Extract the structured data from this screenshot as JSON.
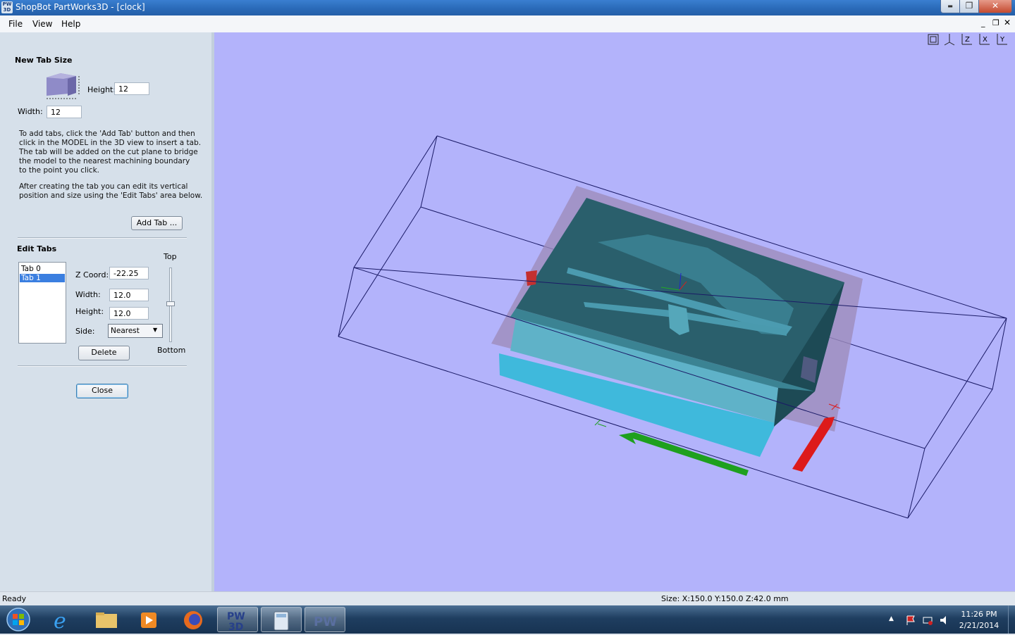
{
  "window": {
    "title": "ShopBot PartWorks3D - [clock]",
    "app_icon_text": "PW\n3D",
    "min_glyph": "▬",
    "max_glyph": "❐",
    "close_glyph": "✕"
  },
  "menubar": {
    "items": [
      "File",
      "View",
      "Help"
    ],
    "mdi_min": "_",
    "mdi_restore": "❐",
    "mdi_close": "✕"
  },
  "tab_size": {
    "heading": "New Tab Size",
    "height_label": "Height:",
    "height_value": "12",
    "width_label": "Width:",
    "width_value": "12",
    "instructions_1": [
      "To add tabs, click the 'Add Tab' button and then",
      "click in the MODEL in the 3D view to insert a tab.",
      "The tab will be added on the cut plane to bridge",
      "the model to the nearest machining boundary",
      "to the point you click."
    ],
    "instructions_2": [
      "After creating the tab you can edit its vertical",
      "position and size using the 'Edit Tabs' area below."
    ],
    "add_tab_label": "Add Tab ..."
  },
  "edit_tabs": {
    "heading": "Edit Tabs",
    "tabs": [
      "Tab 0",
      "Tab 1"
    ],
    "selected_index": 1,
    "z_label": "Z Coord:",
    "z_value": "-22.25",
    "width_label": "Width:",
    "width_value": "12.0",
    "height_label": "Height:",
    "height_value": "12.0",
    "side_label": "Side:",
    "side_value": "Nearest",
    "side_options": [
      "Nearest"
    ],
    "slider_top": "Top",
    "slider_bottom": "Bottom",
    "delete_label": "Delete"
  },
  "close_label": "Close",
  "viewport": {
    "background": "#b3b3fb",
    "view_icons": [
      "fit-view-icon",
      "iso-view-icon",
      "z-view-icon",
      "x-view-icon",
      "y-view-icon"
    ]
  },
  "status": {
    "left": "Ready",
    "size": "Size: X:150.0 Y:150.0 Z:42.0 mm"
  },
  "taskbar": {
    "apps": [
      "start-orb",
      "internet-explorer",
      "file-explorer",
      "media-player",
      "firefox",
      "partworks3d",
      "calculator",
      "partworks"
    ],
    "time": "11:26 PM",
    "date": "2/21/2014"
  }
}
